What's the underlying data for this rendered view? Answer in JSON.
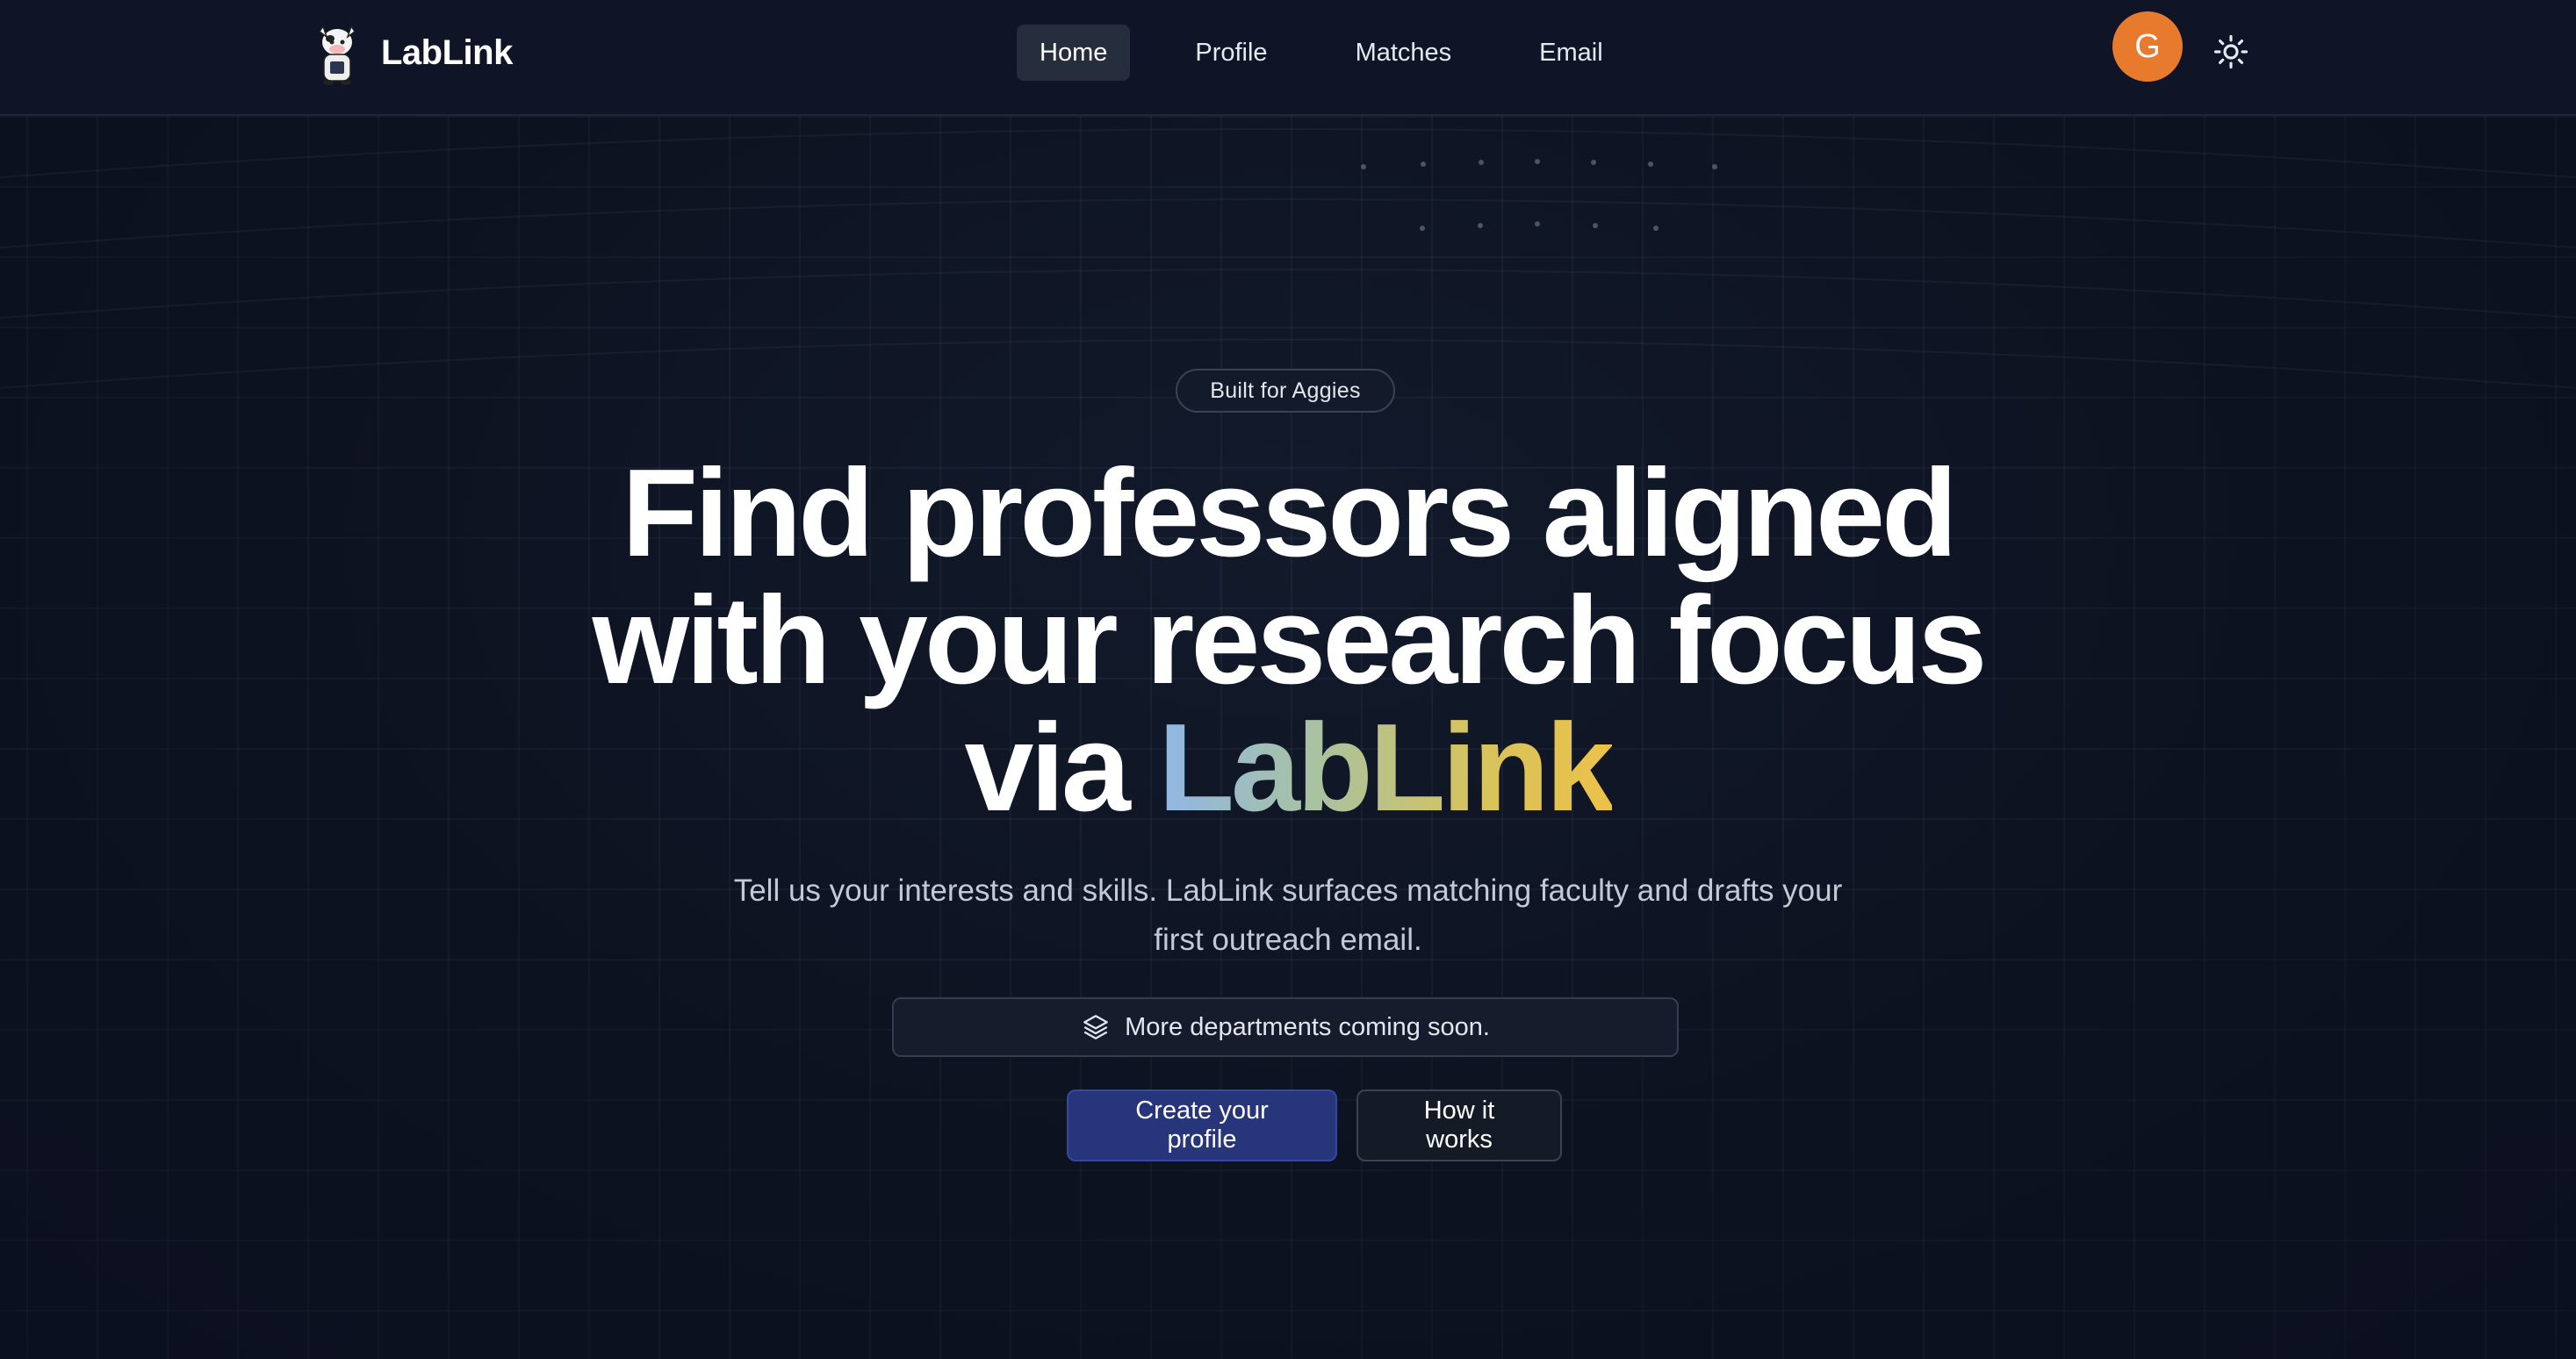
{
  "navbar": {
    "brand_name": "LabLink",
    "logo_icon": "cow-mascot-icon",
    "items": [
      {
        "label": "Home",
        "active": true
      },
      {
        "label": "Profile",
        "active": false
      },
      {
        "label": "Matches",
        "active": false
      },
      {
        "label": "Email",
        "active": false
      }
    ],
    "avatar_initial": "G",
    "avatar_color": "#e87a2e",
    "theme_toggle_icon": "sun-icon"
  },
  "hero": {
    "badge": "Built for Aggies",
    "headline_line1": "Find professors aligned",
    "headline_line2": "with your research focus",
    "headline_line3_prefix": "via ",
    "headline_highlight": "LabLink",
    "subtitle_line1": "Tell us your interests and skills. LabLink surfaces matching faculty and drafts your",
    "subtitle_line2": "first outreach email.",
    "notice_icon": "layers-icon",
    "notice_text": "More departments coming soon.",
    "primary_cta": "Create your profile",
    "secondary_cta": "How it works"
  },
  "colors": {
    "background": "#0d1220",
    "primary_button": "#27367a",
    "highlight_gradient": [
      "#8fb7e6",
      "#a9c2a0",
      "#d7c35d",
      "#ebc248"
    ]
  }
}
